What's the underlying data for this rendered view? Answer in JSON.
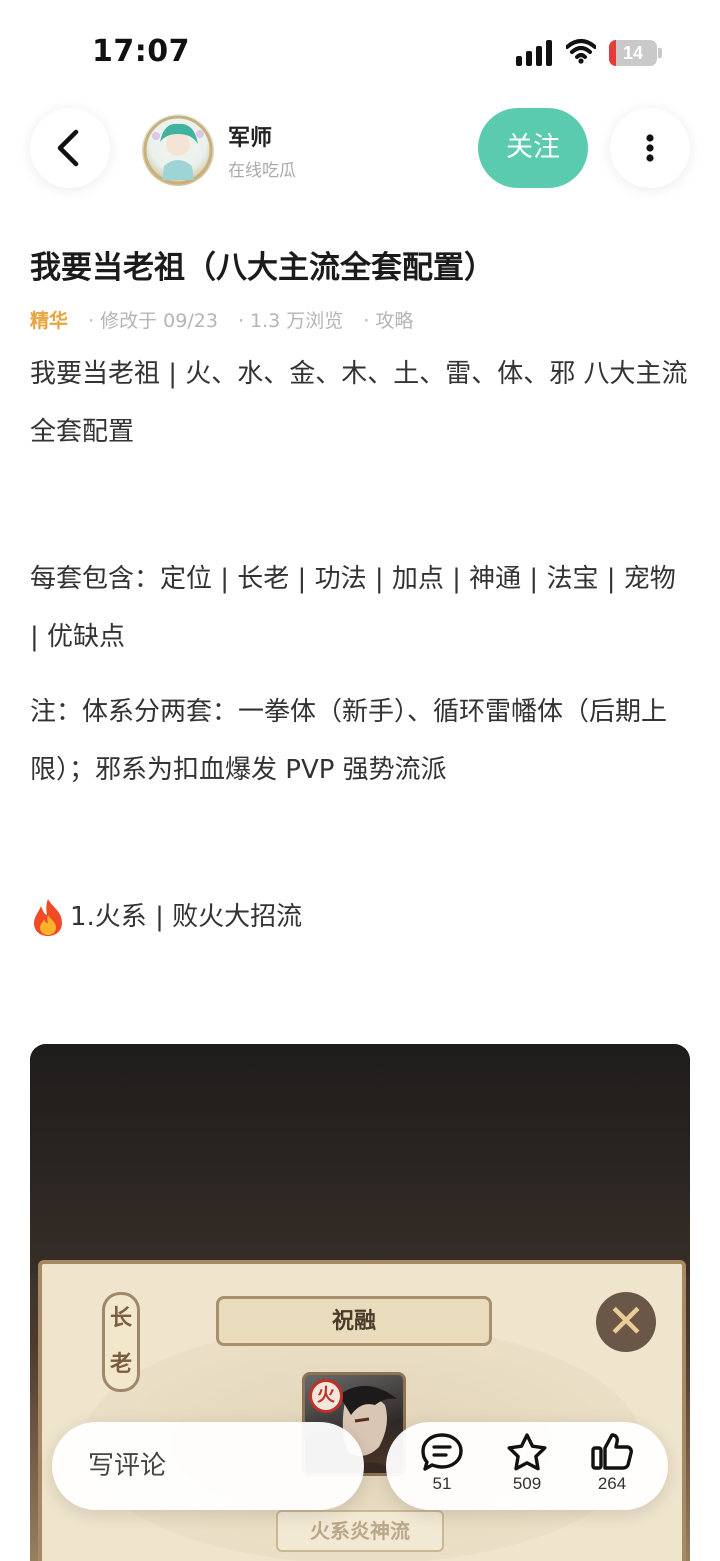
{
  "status_bar": {
    "time": "17:07",
    "battery": "14"
  },
  "header": {
    "author_name": "军师",
    "author_subtitle": "在线吃瓜",
    "follow_label": "关注"
  },
  "post": {
    "title": "我要当老祖（八大主流全套配置）",
    "meta": {
      "tag": "精华",
      "modified": "修改于 09/23",
      "views": "1.3 万浏览",
      "category": "攻略"
    },
    "paragraphs": [
      "我要当老祖 | 火、水、金、木、土、雷、体、邪 八大主流全套配置",
      "每套包含：定位 | 长老 | 功法 | 加点 | 神通 | 法宝 | 宠物 | 优缺点",
      "注：体系分两套：一拳体（新手）、循环雷幡体（后期上限）；邪系为扣血爆发 PVP 强势流派"
    ],
    "section_heading": "1.火系 | 败火大招流",
    "image": {
      "side_tag": "长老",
      "banner_name": "祝融",
      "element_badge": "火",
      "school_label": "火系炎神流"
    }
  },
  "bottom_bar": {
    "comment_placeholder": "写评论",
    "comment_count": "51",
    "favorite_count": "509",
    "like_count": "264"
  },
  "colors": {
    "accent": "#5bcbb0",
    "tag": "#e8a43a",
    "battery_low": "#e63b3b"
  }
}
